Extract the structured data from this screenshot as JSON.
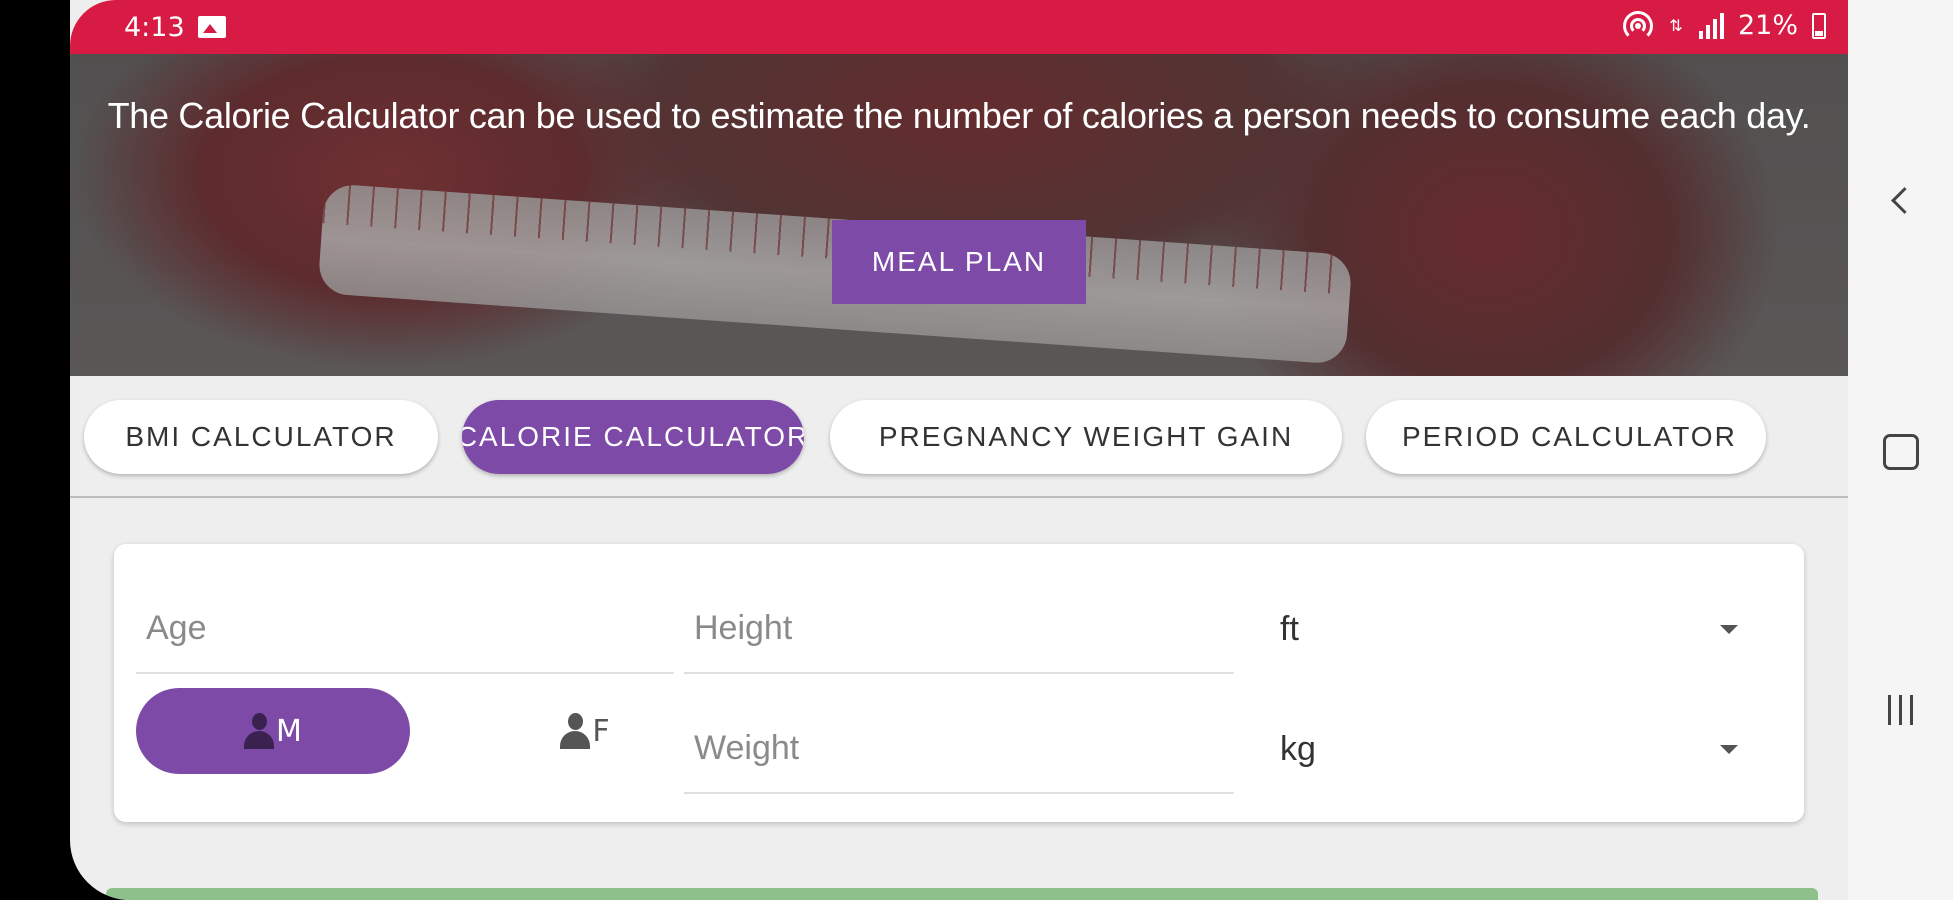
{
  "status_bar": {
    "time": "4:13",
    "battery": "21%"
  },
  "hero": {
    "description": "The Calorie Calculator can be used to estimate the number of calories a person needs to consume each day.",
    "meal_plan_label": "MEAL PLAN"
  },
  "tabs": [
    {
      "label": "BMI CALCULATOR",
      "active": false
    },
    {
      "label": "CALORIE CALCULATOR",
      "active": true
    },
    {
      "label": "PREGNANCY WEIGHT GAIN",
      "active": false
    },
    {
      "label": "PERIOD CALCULATOR",
      "active": false
    }
  ],
  "form": {
    "age_placeholder": "Age",
    "height_placeholder": "Height",
    "height_unit": "ft",
    "weight_placeholder": "Weight",
    "weight_unit": "kg",
    "male_label": "M",
    "female_label": "F"
  },
  "colors": {
    "status_bar": "#d81b45",
    "accent": "#7e4aa7",
    "results_bar": "#8dc08a"
  },
  "icons": [
    "gallery-icon",
    "hotspot-icon",
    "data-icon",
    "signal-icon",
    "battery-icon",
    "person-icon",
    "back-icon",
    "home-icon",
    "recents-icon"
  ]
}
